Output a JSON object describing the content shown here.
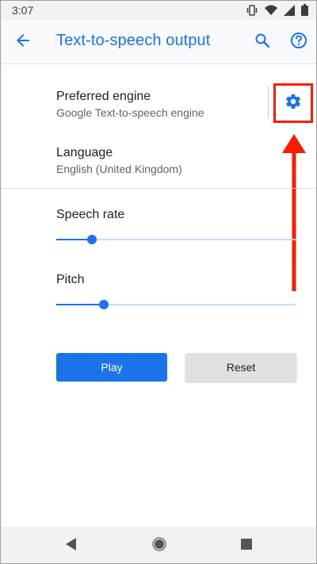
{
  "status_bar": {
    "time": "3:07",
    "icons": [
      "vibrate-icon",
      "wifi-icon",
      "signal-icon",
      "battery-icon"
    ]
  },
  "app_bar": {
    "title": "Text-to-speech output",
    "back_icon": "arrow-back-icon",
    "search_icon": "search-icon",
    "help_icon": "help-icon"
  },
  "settings": {
    "preferred_engine": {
      "title": "Preferred engine",
      "summary": "Google Text-to-speech engine",
      "settings_icon": "gear-icon"
    },
    "language": {
      "title": "Language",
      "summary": "English (United Kingdom)"
    },
    "speech_rate": {
      "label": "Speech rate",
      "value_fraction": 0.15
    },
    "pitch": {
      "label": "Pitch",
      "value_fraction": 0.2
    }
  },
  "buttons": {
    "play": "Play",
    "reset": "Reset"
  },
  "annotation": {
    "highlight_color": "#ff1a00",
    "arrow_icon": "arrow-up-icon"
  },
  "nav_bar": {
    "back_icon": "nav-back-icon",
    "home_icon": "nav-home-icon",
    "recents_icon": "nav-recents-icon"
  },
  "colors": {
    "accent": "#1a73e8",
    "annotation": "#ff1a00"
  }
}
